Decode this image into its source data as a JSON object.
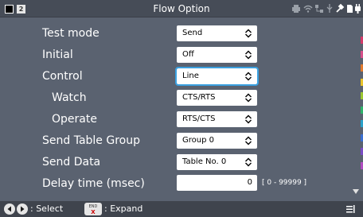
{
  "titlebar": {
    "badge": "2",
    "title": "Flow Option"
  },
  "form": {
    "rows": [
      {
        "label": "Test mode",
        "value": "Send"
      },
      {
        "label": "Initial",
        "value": "Off"
      },
      {
        "label": "Control",
        "value": "Line"
      },
      {
        "label": "Watch",
        "value": "CTS/RTS"
      },
      {
        "label": "Operate",
        "value": "RTS/CTS"
      },
      {
        "label": "Send Table Group",
        "value": "Group 0"
      },
      {
        "label": "Send Data",
        "value": "Table No. 0"
      },
      {
        "label": "Delay time (msec)",
        "value": "0",
        "hint": "[ 0 - 99999 ]"
      }
    ]
  },
  "footer": {
    "select_label": ": Select",
    "expand_label": ": Expand",
    "end_key_top": "END",
    "end_key_bottom": "X"
  },
  "colors": {
    "background": "#5a6270",
    "titlebar": "#464c57",
    "footer": "#3f444d",
    "focus": "#3aa0e0"
  },
  "sidebar_colors": [
    "#d43b6a",
    "#d64f8a",
    "#e07a2e",
    "#e8c32a",
    "#9ac530",
    "#2fb36a",
    "#2aa0c8",
    "#3b6fd0",
    "#7a4cc4",
    "#b04cc0"
  ]
}
